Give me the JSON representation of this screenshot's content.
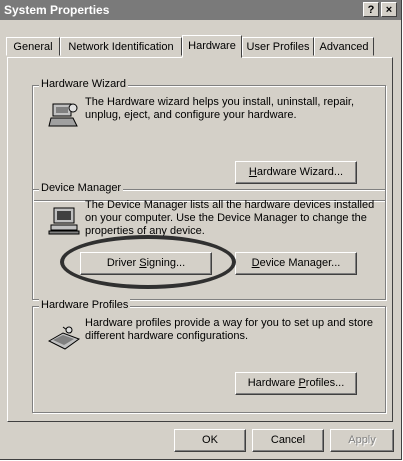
{
  "window": {
    "title": "System Properties",
    "help_label": "?",
    "close_label": "×"
  },
  "tabs": [
    {
      "label": "General"
    },
    {
      "label": "Network Identification"
    },
    {
      "label": "Hardware"
    },
    {
      "label": "User Profiles"
    },
    {
      "label": "Advanced"
    }
  ],
  "hardware_wizard": {
    "title": "Hardware Wizard",
    "description_line1": "The Hardware wizard helps you install, uninstall, repair,",
    "description_line2": "unplug, eject, and configure your hardware.",
    "button_pre": "",
    "button_ul": "H",
    "button_post": "ardware Wizard..."
  },
  "device_manager": {
    "title": "Device Manager",
    "description_line1": "The Device Manager lists all the hardware devices installed",
    "description_line2": "on your computer. Use the Device Manager to change the",
    "description_line3": "properties of any device.",
    "driver_btn_pre": "Driver ",
    "driver_btn_ul": "S",
    "driver_btn_post": "igning...",
    "dm_btn_pre": "",
    "dm_btn_ul": "D",
    "dm_btn_post": "evice Manager..."
  },
  "hardware_profiles": {
    "title": "Hardware Profiles",
    "description_line1": "Hardware profiles provide a way for you to set up and store",
    "description_line2": "different hardware configurations.",
    "button_pre": "Hardware ",
    "button_ul": "P",
    "button_post": "rofiles..."
  },
  "footer": {
    "ok": "OK",
    "cancel": "Cancel",
    "apply": "Apply"
  },
  "colors": {
    "titlebar": "#7a7a7a",
    "face": "#d4d0c8",
    "highlight_ring": "#303030"
  }
}
